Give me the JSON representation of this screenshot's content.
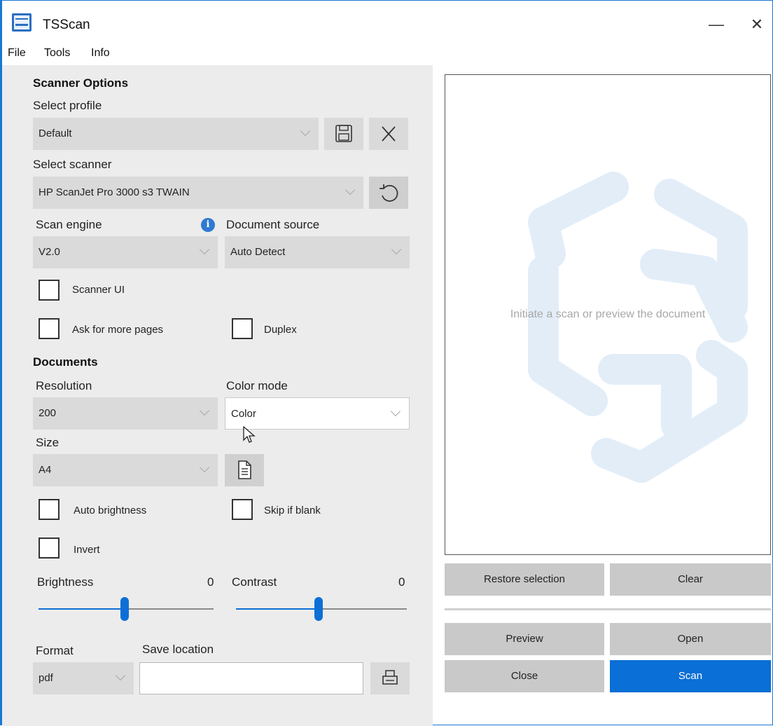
{
  "window": {
    "title": "TSScan",
    "minimize_glyph": "—",
    "close_glyph": "✕"
  },
  "menu": [
    "File",
    "Tools",
    "Info"
  ],
  "scanner_options": {
    "heading": "Scanner Options",
    "profile_label": "Select profile",
    "profile_value": "Default",
    "scanner_label": "Select scanner",
    "scanner_value": "HP ScanJet Pro 3000 s3 TWAIN",
    "engine_label": "Scan engine",
    "engine_value": "V2.0",
    "source_label": "Document source",
    "source_value": "Auto Detect",
    "scanner_ui_label": "Scanner UI",
    "more_pages_label": "Ask for more pages",
    "duplex_label": "Duplex"
  },
  "documents": {
    "heading": "Documents",
    "resolution_label": "Resolution",
    "resolution_value": "200",
    "color_mode_label": "Color mode",
    "color_mode_value": "Color",
    "size_label": "Size",
    "size_value": "A4",
    "auto_brightness_label": "Auto brightness",
    "skip_blank_label": "Skip if blank",
    "invert_label": "Invert",
    "brightness_label": "Brightness",
    "brightness_value": "0",
    "contrast_label": "Contrast",
    "contrast_value": "0",
    "format_label": "Format",
    "format_value": "pdf",
    "save_location_label": "Save location",
    "save_location_value": ""
  },
  "preview": {
    "placeholder": "Initiate a scan or preview the document"
  },
  "buttons": {
    "restore": "Restore selection",
    "clear": "Clear",
    "preview": "Preview",
    "open": "Open",
    "close": "Close",
    "scan": "Scan"
  },
  "colors": {
    "accent": "#0a6fd6",
    "panel": "#ececec",
    "button": "#c9c9c9"
  }
}
